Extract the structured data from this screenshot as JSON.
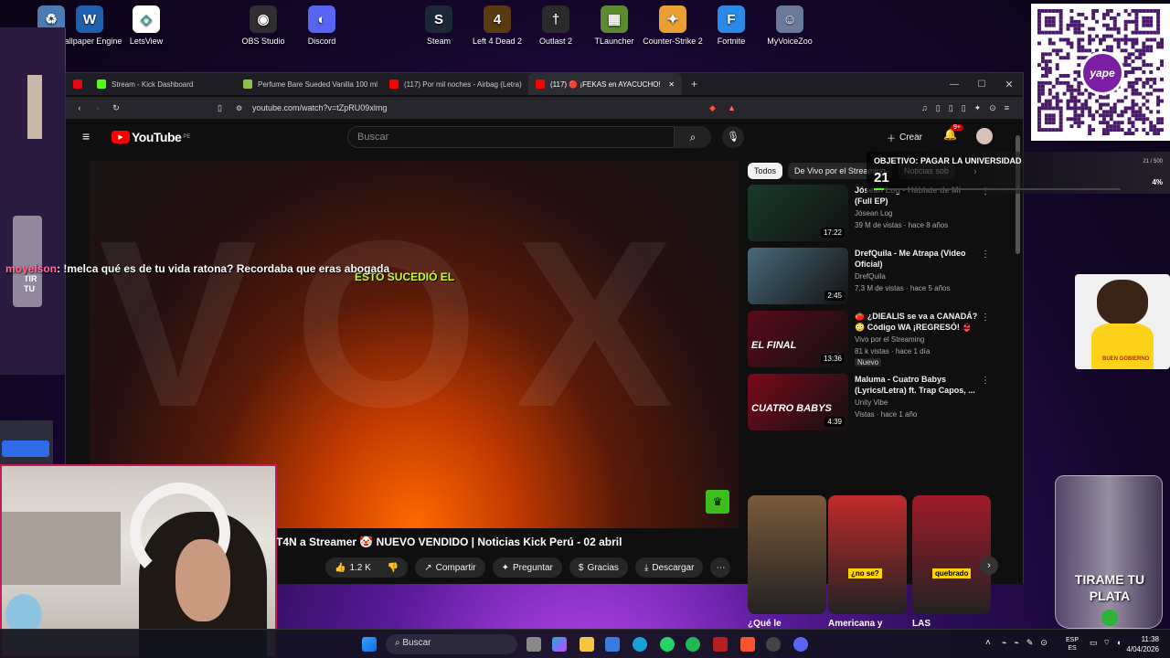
{
  "desktop": {
    "icons": [
      {
        "label": "",
        "glyph": "♻",
        "color": "#4a7bb5"
      },
      {
        "label": "Wallpaper Engine",
        "glyph": "W",
        "color": "#1e5fae"
      },
      {
        "label": "LetsView",
        "glyph": "◇",
        "color": "#ffffff"
      },
      {
        "label": "OBS Studio",
        "glyph": "◉",
        "color": "#302e31"
      },
      {
        "label": "Discord",
        "glyph": "◐",
        "color": "#5865f2"
      },
      {
        "label": "Steam",
        "glyph": "S",
        "color": "#1b2838"
      },
      {
        "label": "Left 4 Dead 2",
        "glyph": "4",
        "color": "#5a3a10"
      },
      {
        "label": "Outlast 2",
        "glyph": "†",
        "color": "#2a2a2a"
      },
      {
        "label": "TLauncher",
        "glyph": "▦",
        "color": "#5b8a2f"
      },
      {
        "label": "Counter-Strike 2",
        "glyph": "✦",
        "color": "#e8a033"
      },
      {
        "label": "Fortnite",
        "glyph": "F",
        "color": "#2a8ae6"
      },
      {
        "label": "MyVoiceZoo",
        "glyph": "☺",
        "color": "#6a7a9a"
      }
    ]
  },
  "browser": {
    "tabs": [
      {
        "label": "",
        "fav_color": "#e50914",
        "active": false
      },
      {
        "label": "Stream - Kick Dashboard",
        "fav_color": "#53fc18",
        "active": false
      },
      {
        "label": "Perfume Bare Sueded Vanilla 100 ml",
        "fav_color": "#8bc34a",
        "active": false
      },
      {
        "label": "(117) Por mil noches - Airbag (Letra)",
        "fav_color": "#ff0000",
        "active": false
      },
      {
        "label": "(117) 🔴 ¡FEKAS en AYACUCHO!",
        "fav_color": "#ff0000",
        "active": true
      }
    ],
    "url": "youtube.com/watch?v=tZpRU09xlmg",
    "new_tab": "+"
  },
  "youtube": {
    "logo": "YouTube",
    "region": "PE",
    "search_placeholder": "Buscar",
    "create_label": "Crear",
    "notif_count": "9+",
    "video_overlay_text": "ESTO SUCEDIÓ EL",
    "watermark": "VOX",
    "video_title": "T4N a Streamer 🤡 NUEVO VENDIDO | Noticias Kick Perú - 02 abril",
    "actions": {
      "likes": "1.2 K",
      "share": "Compartir",
      "ask": "Preguntar",
      "thanks": "Gracias",
      "download": "Descargar"
    },
    "chips": [
      "Todos",
      "De Vivo por el Streaming",
      "Noticias sob"
    ],
    "sidebar": [
      {
        "title": "Jósean Log - Háblate de Mí (Full EP)",
        "channel": "Jósean Log",
        "meta": "39 M de vistas · hace 8 años",
        "duration": "17:22",
        "badge": "",
        "thumb_color": "#1a3a2a"
      },
      {
        "title": "DrefQuila - Me Atrapa (Video Oficial)",
        "channel": "DrefQuila",
        "meta": "7.3 M de vistas · hace 5 años",
        "duration": "2:45",
        "badge": "",
        "thumb_color": "#4a6a7a"
      },
      {
        "title": "🍅 ¿DIEALIS se va a CANADÁ? 😳 Código WA ¡REGRESÓ! 👙",
        "channel": "Vivo por el Streaming",
        "meta": "81 k vistas · hace 1 día",
        "duration": "13:36",
        "badge": "Nuevo",
        "thumb_color": "#5a0a1a",
        "thumb_text": "EL FINAL"
      },
      {
        "title": "Maluma - Cuatro Babys (Lyrics/Letra) ft. Trap Capos, ...",
        "channel": "Unity Vibe",
        "meta": "Vistas · hace 1 año",
        "duration": "4:39",
        "badge": "",
        "thumb_color": "#7a0a1a",
        "thumb_text": "CUATRO BABYS"
      }
    ],
    "shorts": [
      {
        "caption": "¿Qué le",
        "color": "#7a5a3a",
        "overlay": ""
      },
      {
        "caption": "Americana y",
        "color": "#c02a2a",
        "overlay": "¿no se?"
      },
      {
        "caption": "LAS",
        "color": "#a01a2a",
        "overlay": "quebrado"
      }
    ]
  },
  "stream_overlay": {
    "chat_user": "moyelson",
    "chat_message": ": !melca qué es de tu vida ratona? Recordaba que eras abogada",
    "goal_title": "OBJETIVO: PAGAR LA UNIVERSIDAD",
    "goal_number": "21",
    "goal_progress": "21 / 500",
    "goal_percent": "4%",
    "goal_fraction": 0.042,
    "jar_text": "TIRAME TU PLATA",
    "left_jar_text": "TIR TU",
    "qr_label": "yape",
    "dog_label": "BUEN GOBIERNO"
  },
  "taskbar": {
    "search": "Buscar",
    "lang": "ESP",
    "lang2": "ES",
    "time": "11:38",
    "date": "4/04/2026"
  },
  "colors": {
    "yt_red": "#ff0000",
    "kick_green": "#53fc18",
    "accent_orange": "#ff6a00"
  }
}
